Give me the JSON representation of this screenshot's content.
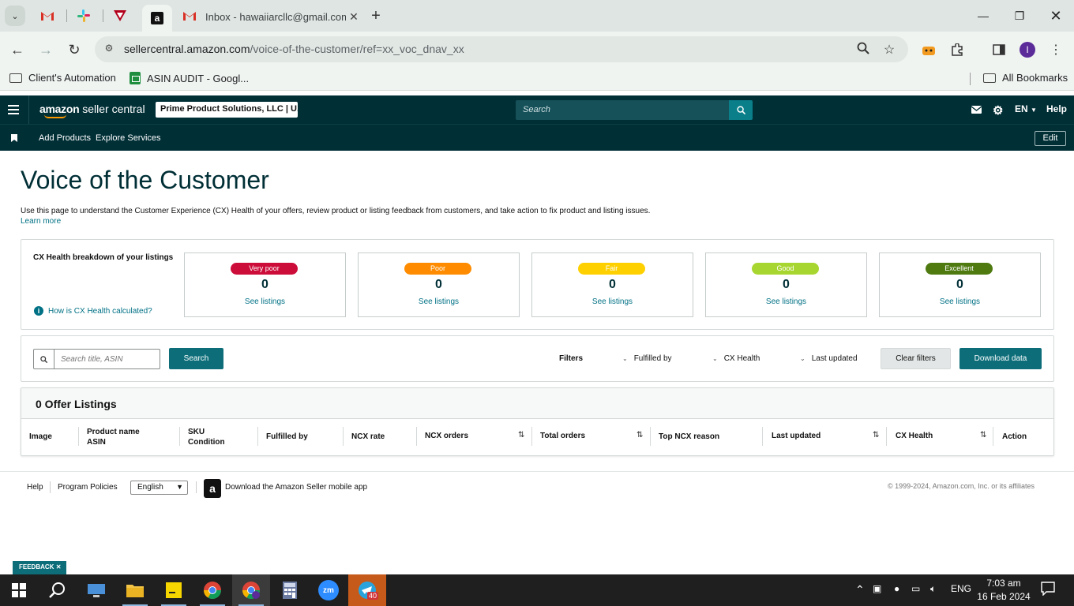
{
  "browser": {
    "inbox_tab_title": "Inbox - hawaiiarcllc@gmail.com",
    "url_host": "sellercentral.amazon.com",
    "url_path": "/voice-of-the-customer/ref=xx_voc_dnav_xx",
    "bookmarks": [
      {
        "label": "Client's Automation",
        "icon": "folder-icon"
      },
      {
        "label": "ASIN AUDIT - Googl...",
        "icon": "sheets-icon"
      }
    ],
    "all_bookmarks": "All Bookmarks",
    "profile_initial": "I"
  },
  "header": {
    "logo_text_bold": "amazon",
    "logo_text": " seller central",
    "account": "Prime Product Solutions, LLC | U...",
    "search_placeholder": "Search",
    "language": "EN",
    "help": "Help"
  },
  "subnav": {
    "items": [
      "Add Products",
      "Explore Services"
    ],
    "edit": "Edit"
  },
  "page": {
    "title": "Voice of the Customer",
    "description": "Use this page to understand the Customer Experience (CX) Health of your offers, review product or listing feedback from customers, and take action to fix product and listing issues.",
    "learn_more": "Learn more"
  },
  "cx_health": {
    "heading": "CX Health breakdown of your listings",
    "how_link": "How is CX Health calculated?",
    "tiles": [
      {
        "label": "Very poor",
        "count": "0",
        "link": "See listings",
        "color": "#cc0c39",
        "text_color": "#ffffff"
      },
      {
        "label": "Poor",
        "count": "0",
        "link": "See listings",
        "color": "#ff8c00",
        "text_color": "#ffffff"
      },
      {
        "label": "Fair",
        "count": "0",
        "link": "See listings",
        "color": "#ffd000",
        "text_color": "#ffffff"
      },
      {
        "label": "Good",
        "count": "0",
        "link": "See listings",
        "color": "#a8d630",
        "text_color": "#ffffff"
      },
      {
        "label": "Excellent",
        "count": "0",
        "link": "See listings",
        "color": "#4e7a10",
        "text_color": "#ffffff"
      }
    ]
  },
  "filters": {
    "search_placeholder": "Search title, ASIN",
    "search_button": "Search",
    "label": "Filters",
    "dropdowns": [
      "Fulfilled by",
      "CX Health",
      "Last updated"
    ],
    "clear": "Clear filters",
    "download": "Download data"
  },
  "listings": {
    "title": "0 Offer Listings",
    "columns": {
      "image": "Image",
      "product_name": "Product name",
      "asin": "ASIN",
      "sku": "SKU",
      "condition": "Condition",
      "fulfilled_by": "Fulfilled by",
      "ncx_rate": "NCX rate",
      "ncx_orders": "NCX orders",
      "total_orders": "Total orders",
      "top_ncx_reason": "Top NCX reason",
      "last_updated": "Last updated",
      "cx_health": "CX Health",
      "action": "Action"
    }
  },
  "footer": {
    "help": "Help",
    "policies": "Program Policies",
    "language": "English",
    "app_text": "Download the Amazon Seller mobile app",
    "copyright": "© 1999-2024, Amazon.com, Inc. or its affiliates"
  },
  "feedback": "FEEDBACK",
  "taskbar": {
    "telegram_badge": "40",
    "language": "ENG",
    "time": "7:03 am",
    "date": "16 Feb 2024"
  },
  "colors": {
    "header_bg": "#002f36",
    "link": "#007185",
    "primary_button": "#0d6e7a"
  }
}
